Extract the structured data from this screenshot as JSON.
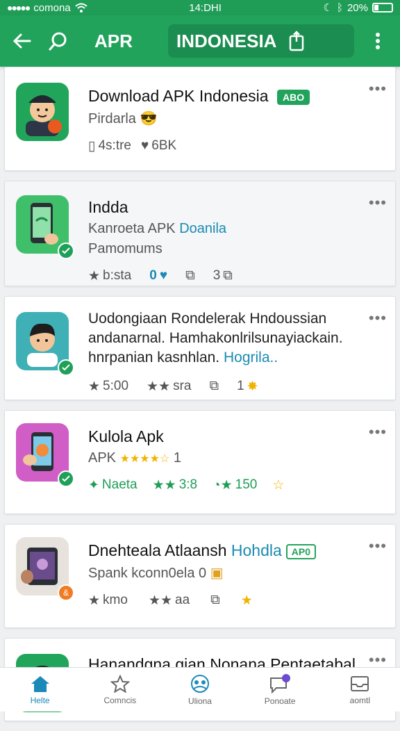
{
  "statusbar": {
    "carrier": "comona",
    "time": "14:DHI",
    "battery": "20%"
  },
  "appbar": {
    "title": "APR",
    "query": "INDONESIA"
  },
  "cards": [
    {
      "name": "Download APK Indonesia",
      "badge": "ABO",
      "sub": "Pirdarla",
      "desc": "",
      "meta": [
        "4s:tre",
        "6BK"
      ]
    },
    {
      "name": "Indda",
      "sub_plain": "Kanroeta APK ",
      "sub_link": "Doanila",
      "sub2": "Pamomums",
      "meta": [
        "b:sta",
        "0",
        "3"
      ]
    },
    {
      "line1": "Uodongiaan Rondelerak Hndoussian",
      "line2": "andanarnal. Hamhakonlrilsunayiackain.",
      "line3_plain": "hnrpanian kasnhlan. ",
      "line3_link": "Hogrila..",
      "meta": [
        "5:00",
        "sra",
        "1"
      ]
    },
    {
      "name": "Kulola Apk",
      "sub": "APK",
      "rating_count": "1",
      "meta": [
        "Naeta",
        "3:8",
        "150"
      ]
    },
    {
      "name_plain": "Dnehteala Atlaansh ",
      "name_link": "Hohdla",
      "badge": "AP0",
      "sub": "Spank kconn0ela 0",
      "meta": [
        "kmo",
        "aa"
      ]
    },
    {
      "name": "Hanandgna gian Nonana Pentaetabal"
    }
  ],
  "nav": [
    {
      "label": "Helte"
    },
    {
      "label": "Comncis"
    },
    {
      "label": "Uliona"
    },
    {
      "label": "Ponoate"
    },
    {
      "label": "aomtl"
    }
  ],
  "colors": {
    "primary": "#22a35c",
    "link": "#1a8ab2",
    "star": "#f0b400"
  }
}
